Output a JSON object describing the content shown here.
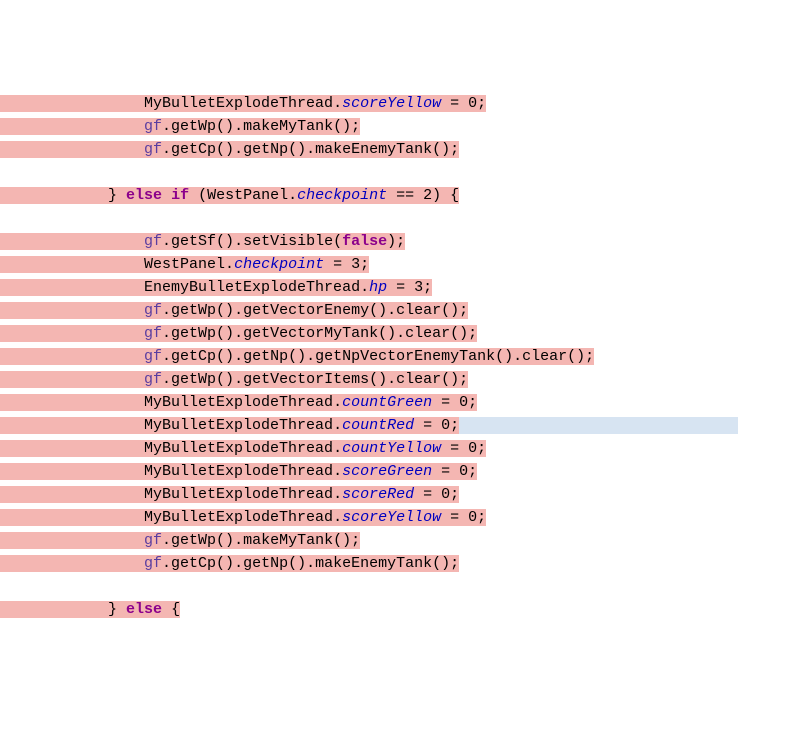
{
  "chart_data": null,
  "code": {
    "indent1": "                ",
    "indent0": "            ",
    "cls_MyBullet": "MyBulletExplodeThread",
    "cls_EnemyBullet": "EnemyBulletExplodeThread",
    "cls_WestPanel": "WestPanel",
    "gf": "gf",
    "fields": {
      "scoreYellow": "scoreYellow",
      "scoreGreen": "scoreGreen",
      "scoreRed": "scoreRed",
      "countGreen": "countGreen",
      "countRed": "countRed",
      "countYellow": "countYellow",
      "checkpoint": "checkpoint",
      "hp": "hp"
    },
    "calls": {
      "getWp": ".getWp()",
      "getCp": ".getCp()",
      "getNp": ".getNp()",
      "getSf": ".getSf()",
      "makeMyTank": ".makeMyTank();",
      "makeEnemyTank": ".makeEnemyTank();",
      "getVectorEnemy_clear": ".getVectorEnemy().clear();",
      "getVectorMyTank_clear": ".getVectorMyTank().clear();",
      "getNpVectorEnemyTank_clear": ".getNpVectorEnemyTank().clear();",
      "getVectorItems_clear": ".getVectorItems().clear();",
      "setVisible_open": ".setVisible("
    },
    "kw": {
      "else": "else",
      "if": "if",
      "false": "false"
    },
    "nums": {
      "eq0": " = 0;",
      "eq3": " = 3;",
      "eq2": " == 2) {"
    },
    "punct": {
      "dot": ".",
      "close_paren_sc": ");",
      "open_elseif": "} ",
      "if_open": " (",
      "else_open": " {"
    }
  }
}
